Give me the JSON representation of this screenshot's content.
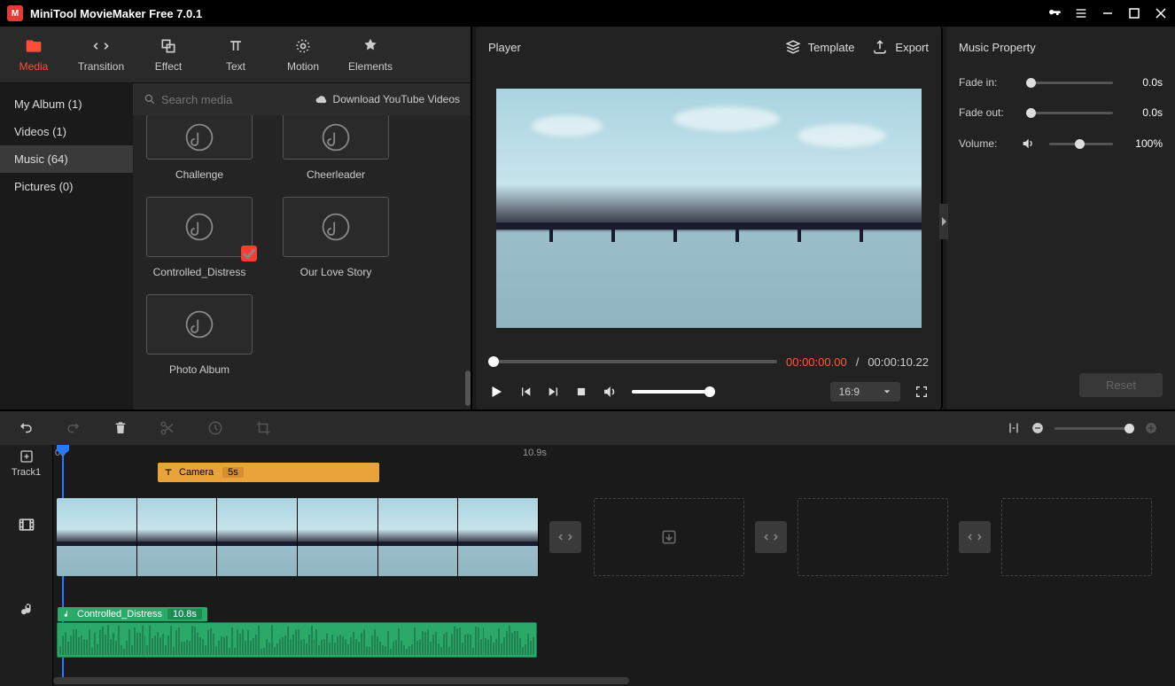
{
  "app": {
    "title": "MiniTool MovieMaker Free 7.0.1"
  },
  "topTabs": {
    "media": "Media",
    "transition": "Transition",
    "effect": "Effect",
    "text": "Text",
    "motion": "Motion",
    "elements": "Elements"
  },
  "sidebar": {
    "myAlbum": "My Album (1)",
    "videos": "Videos (1)",
    "music": "Music (64)",
    "pictures": "Pictures (0)"
  },
  "search": {
    "placeholder": "Search media"
  },
  "download": "Download YouTube Videos",
  "mediaItems": {
    "challenge": "Challenge",
    "cheerleader": "Cheerleader",
    "controlled": "Controlled_Distress",
    "ourlove": "Our Love Story",
    "photo": "Photo Album"
  },
  "player": {
    "title": "Player",
    "template": "Template",
    "export": "Export",
    "curTime": "00:00:00.00",
    "sep": "/",
    "totTime": "00:00:10.22",
    "aspect": "16:9"
  },
  "props": {
    "title": "Music Property",
    "fadeIn": "Fade in:",
    "fadeInVal": "0.0s",
    "fadeOut": "Fade out:",
    "fadeOutVal": "0.0s",
    "volume": "Volume:",
    "volumeVal": "100%",
    "reset": "Reset"
  },
  "timeline": {
    "track1": "Track1",
    "t0": "0s",
    "t1": "10.9s",
    "textClip": "Camera",
    "textDur": "5s",
    "audioClip": "Controlled_Distress",
    "audioDur": "10.8s"
  }
}
